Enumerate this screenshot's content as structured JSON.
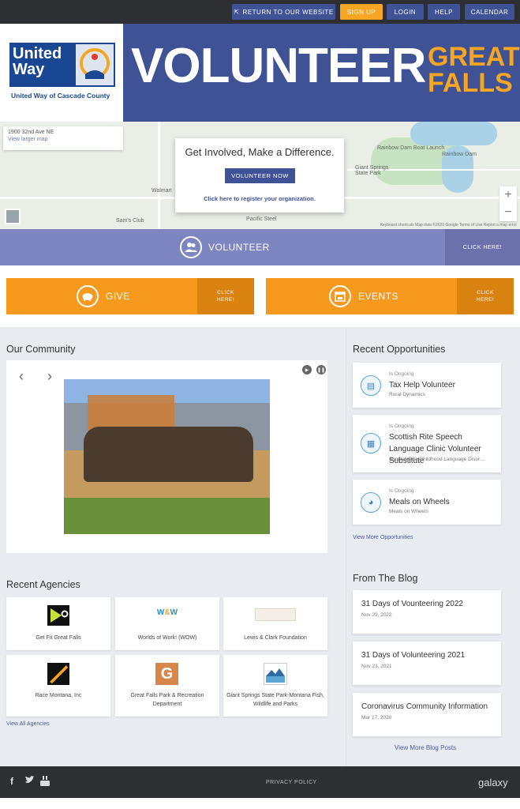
{
  "topnav": {
    "return": "RETURN TO OUR WEBSITE",
    "signup": "SIGN UP",
    "login": "LOGIN",
    "help": "HELP",
    "calendar": "CALENDAR"
  },
  "header": {
    "logo_text": "United Way",
    "logo_sub": "United Way of Cascade County",
    "banner_main": "VOLUNTEER",
    "banner_accent_1": "GREAT",
    "banner_accent_2": "FALLS"
  },
  "map": {
    "address": "1900 32nd Ave NE",
    "larger_map": "View larger map",
    "labels": {
      "rainbow_dam_boat": "Rainbow Dam Boat Launch",
      "giant_springs": "Giant Springs State Park",
      "rainbow_dam": "Rainbow Dam",
      "walmart": "Walmart",
      "sams_club": "Sam's Club",
      "ps_dam": "Pacific Steel"
    },
    "footer": "Keyboard shortcuts   Map data ©2020 Google   Terms of Use   Report a map error"
  },
  "cta": {
    "title": "Get Involved, Make a Difference.",
    "button": "VOLUNTEER NOW",
    "link": "Click here to register your organization."
  },
  "volunteer_band": {
    "label": "VOLUNTEER",
    "click": "CLICK HERE!"
  },
  "give": {
    "label": "GIVE",
    "click_1": "CLICK",
    "click_2": "HERE!"
  },
  "events": {
    "label": "EVENTS",
    "click_1": "CLICK",
    "click_2": "HERE!"
  },
  "community": {
    "title": "Our Community"
  },
  "opportunities": {
    "title": "Recent Opportunities",
    "items": [
      {
        "tag": "Is Ongoing",
        "title": "Tax Help Volunteer",
        "org": "Rural Dynamics"
      },
      {
        "tag": "Is Ongoing",
        "title": "Scottish Rite Speech Language Clinic Volunteer Substitute",
        "org": "Scottish Rite Childhood Language Disor..."
      },
      {
        "tag": "Is Ongoing",
        "title": "Meals on Wheels",
        "org": "Meals on Wheels"
      }
    ],
    "view_more": "View More Opportunities"
  },
  "agencies": {
    "title": "Recent Agencies",
    "items": [
      {
        "name": "Get Fit Great Falls"
      },
      {
        "name": "Worlds of Work! (WOW)"
      },
      {
        "name": "Lewis & Clark Foundation"
      },
      {
        "name": "Race Montana, Inc"
      },
      {
        "name": "Great Falls Park & Recreation Department"
      },
      {
        "name": "Giant Springs State Park-Montana Fish, Wildlife and Parks"
      }
    ],
    "view_all": "View All Agencies"
  },
  "blog": {
    "title": "From The Blog",
    "posts": [
      {
        "title": "31 Days of Vounteering 2022",
        "date": "Nov 29, 2022"
      },
      {
        "title": "31 Days of Volunteering 2021",
        "date": "Nov 23, 2021"
      },
      {
        "title": "Coronavirus Community Information",
        "date": "Mar 17, 2020"
      }
    ],
    "view_more": "View More Blog Posts"
  },
  "footer": {
    "privacy": "PRIVACY POLICY",
    "brand": "galaxy"
  },
  "colors": {
    "primary": "#3f5296",
    "accent": "#f6a623",
    "orange": "#f7991c",
    "volunteer_band": "#7e86c2",
    "dark": "#2d2f33"
  }
}
